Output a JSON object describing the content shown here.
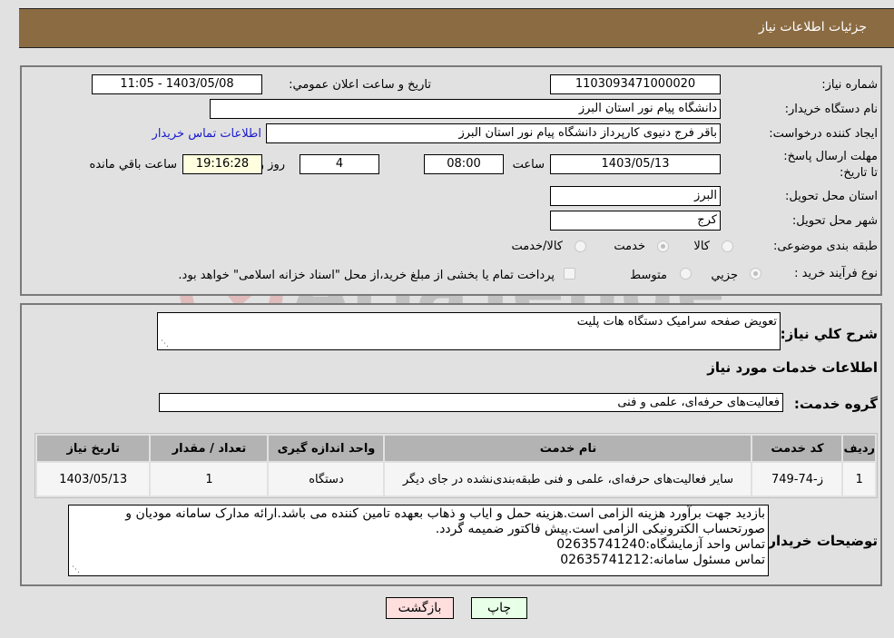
{
  "header": {
    "title": "جزئيات اطلاعات نياز"
  },
  "details": {
    "need_number_label": "شماره نیاز:",
    "need_number": "1103093471000020",
    "announce_label": "تاریخ و ساعت اعلان عمومي:",
    "announce_value": "1403/05/08 - 11:05",
    "buyer_org_label": "نام دستگاه خریدار:",
    "buyer_org": "دانشگاه پیام نور استان البرز",
    "creator_label": "ایجاد کننده درخواست:",
    "creator": "باقر فرج دنیوی کارپرداز دانشگاه پیام نور استان البرز",
    "contact_link": "اطلاعات تماس خریدار",
    "deadline_label": "مهلت ارسال پاسخ: تا تاریخ:",
    "deadline_date": "1403/05/13",
    "time_label": "ساعت",
    "deadline_time": "08:00",
    "days_value": "4",
    "days_label": "روز و",
    "remaining_time": "19:16:28",
    "remaining_label": "ساعت باقي مانده",
    "province_label": "استان محل تحویل:",
    "province": "البرز",
    "city_label": "شهر محل تحویل:",
    "city": "کرج",
    "category_label": "طبقه بندی موضوعی:",
    "category_options": [
      {
        "label": "کالا",
        "checked": false
      },
      {
        "label": "خدمت",
        "checked": true
      },
      {
        "label": "کالا/خدمت",
        "checked": false
      }
    ],
    "purchase_type_label": "نوع فرآیند خرید :",
    "purchase_options": [
      {
        "label": "جزيي",
        "checked": true
      },
      {
        "label": "متوسط",
        "checked": false
      }
    ],
    "treasury_note": "پرداخت تمام یا بخشی از مبلغ خرید،از محل \"اسناد خزانه اسلامی\" خواهد بود."
  },
  "description": {
    "label": "شرح کلي نياز:",
    "value": "تعویض صفحه سرامیک دستگاه هات پلیت"
  },
  "services": {
    "section_title": "اطلاعات خدمات مورد نياز",
    "group_label": "گروه خدمت:",
    "group_value": "فعالیت‌های حرفه‌ای، علمی و فنی",
    "columns": [
      "رديف",
      "کد خدمت",
      "نام خدمت",
      "واحد اندازه گيری",
      "تعداد / مقدار",
      "تاريخ نياز"
    ],
    "rows": [
      {
        "row": "1",
        "code": "ز-74-749",
        "name": "سایر فعالیت‌های حرفه‌ای، علمی و فنی طبقه‌بندی‌نشده در جای دیگر",
        "unit": "دستگاه",
        "quantity": "1",
        "date": "1403/05/13"
      }
    ]
  },
  "buyer_notes": {
    "label": "توضيحات خريدار:",
    "lines": [
      "بازدید جهت برآورد هزینه الزامی است.هزینه حمل و ایاب و ذهاب بعهده تامین کننده می باشد.ارائه مدارک سامانه مودیان و صورتحساب الکترونیکی الزامی است.پیش فاکتور ضمیمه گردد.",
      "تماس واحد آزمایشگاه:02635741240",
      "تماس مسئول سامانه:02635741212"
    ]
  },
  "buttons": {
    "back": "بازگشت",
    "print": "چاپ"
  },
  "watermark": {
    "text": "AriaTender.neT"
  }
}
